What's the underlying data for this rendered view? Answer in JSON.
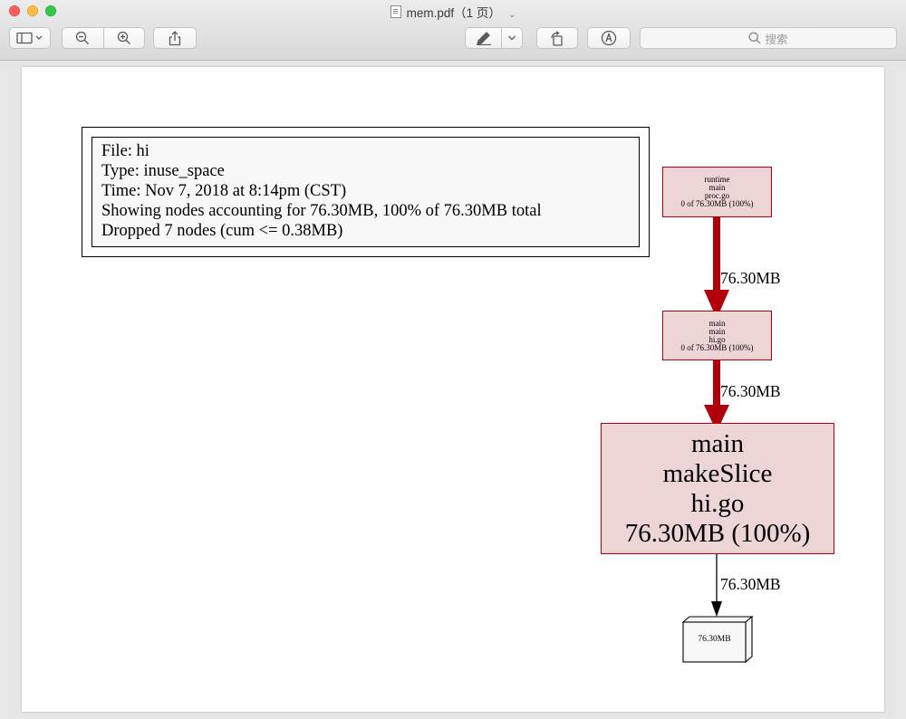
{
  "window": {
    "title": "mem.pdf（1 页）",
    "doc_icon": "pdf-doc-icon",
    "search_placeholder": "搜索"
  },
  "toolbar": {
    "buttons": [
      "sidebar-toggle",
      "zoom-out",
      "zoom-in",
      "share",
      "markup",
      "markup-menu",
      "rotate",
      "annotate"
    ]
  },
  "legend": {
    "file": "File: hi",
    "type": "Type: inuse_space",
    "time": "Time: Nov 7, 2018 at 8:14pm (CST)",
    "showing": "Showing nodes accounting for 76.30MB, 100% of 76.30MB total",
    "dropped": "Dropped 7 nodes (cum <= 0.38MB)"
  },
  "nodes": {
    "runtime_main": {
      "l1": "runtime",
      "l2": "main",
      "l3": "proc.go",
      "l4": "0 of 76.30MB (100%)"
    },
    "main_main": {
      "l1": "main",
      "l2": "main",
      "l3": "hi.go",
      "l4": "0 of 76.30MB (100%)"
    },
    "make_slice": {
      "l1": "main",
      "l2": "makeSlice",
      "l3": "hi.go",
      "l4": "76.30MB (100%)"
    },
    "alloc_box": {
      "label": "76.30MB"
    }
  },
  "edges": {
    "e1": "76.30MB",
    "e2": "76.30MB",
    "e3": "76.30MB"
  },
  "colors": {
    "hot_edge": "#b2000b",
    "node_fill": "#edd5d5",
    "node_border": "#b2000b"
  }
}
